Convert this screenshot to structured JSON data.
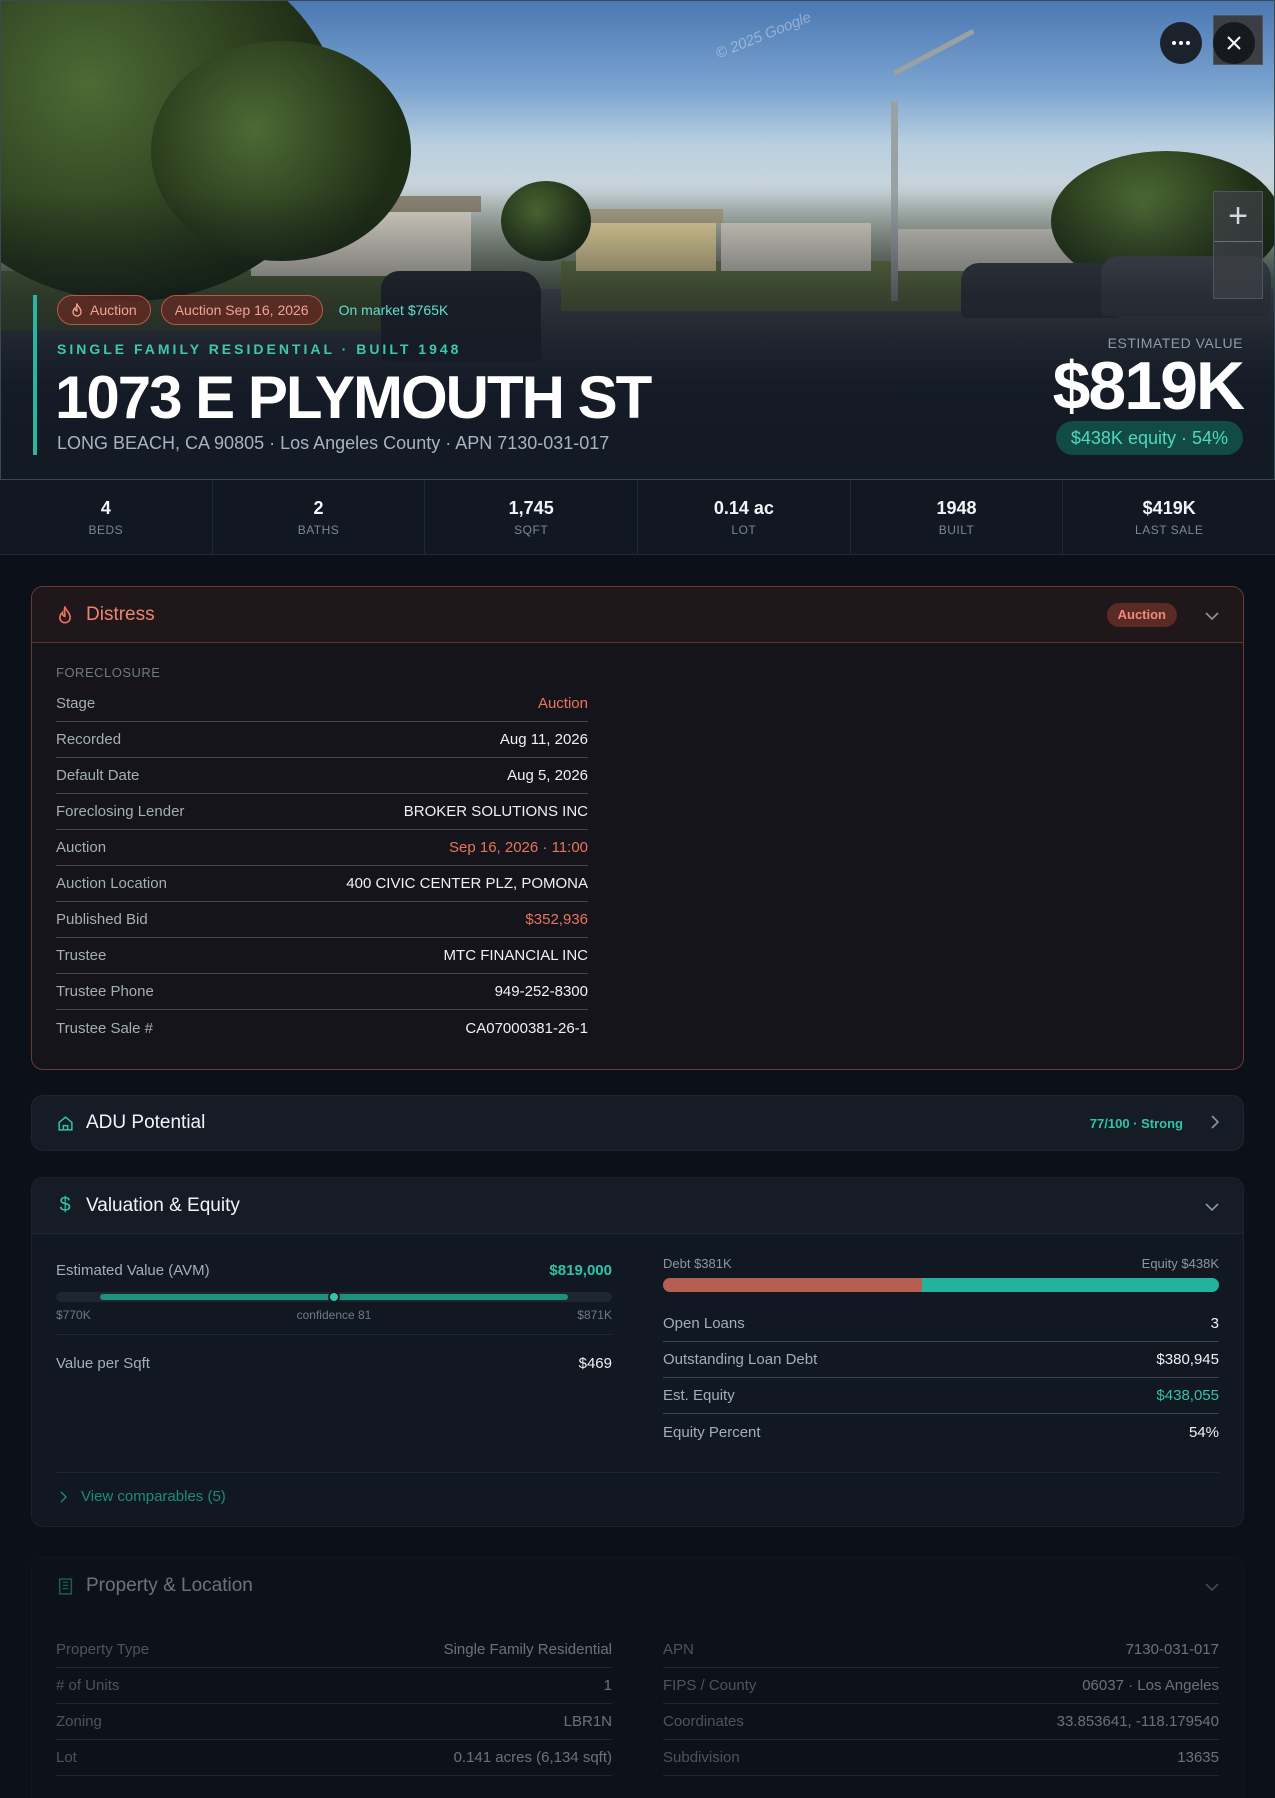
{
  "hero": {
    "watermark": "© 2025 Google",
    "more_icon": "ellipsis-icon",
    "close_icon": "close-icon",
    "zoom_in_icon": "plus-icon",
    "pills": [
      {
        "label": "Auction",
        "icon": "flame-icon"
      },
      {
        "label": "Auction Sep 16, 2026"
      },
      {
        "label": "On market $765K"
      }
    ],
    "subtitle": "SINGLE FAMILY RESIDENTIAL · BUILT 1948",
    "address": "1073 E PLYMOUTH ST",
    "location": "LONG BEACH, CA 90805 · Los Angeles County · APN 7130-031-017",
    "estimated_label": "ESTIMATED VALUE",
    "estimated_value": "$819K",
    "equity": "$438K equity · 54%"
  },
  "stats": [
    {
      "value": "4",
      "label": "BEDS"
    },
    {
      "value": "2",
      "label": "BATHS"
    },
    {
      "value": "1,745",
      "label": "SQFT"
    },
    {
      "value": "0.14 ac",
      "label": "LOT"
    },
    {
      "value": "1948",
      "label": "BUILT"
    },
    {
      "value": "$419K",
      "label": "LAST SALE"
    }
  ],
  "distress": {
    "title": "Distress",
    "icon": "flame-icon",
    "badge": "Auction",
    "section_label": "FORECLOSURE",
    "rows": [
      {
        "k": "Stage",
        "v": "Auction"
      },
      {
        "k": "Recorded",
        "v": "Aug 11, 2026"
      },
      {
        "k": "Default Date",
        "v": "Aug 5, 2026"
      },
      {
        "k": "Foreclosing Lender",
        "v": "BROKER SOLUTIONS INC"
      },
      {
        "k": "Auction",
        "v": "Sep 16, 2026 · 11:00"
      },
      {
        "k": "Auction Location",
        "v": "400 CIVIC CENTER PLZ, POMONA"
      },
      {
        "k": "Published Bid",
        "v": "$352,936"
      },
      {
        "k": "Trustee",
        "v": "MTC FINANCIAL INC"
      },
      {
        "k": "Trustee Phone",
        "v": "949-252-8300"
      },
      {
        "k": "Trustee Sale #",
        "v": "CA07000381-26-1"
      }
    ]
  },
  "adu": {
    "title": "ADU Potential",
    "icon": "home-icon",
    "score": "77/100 · Strong"
  },
  "valuation": {
    "title": "Valuation & Equity",
    "icon": "dollar-icon",
    "avm_label": "Estimated Value (AVM)",
    "avm_value": "$819,000",
    "range_low": "$770K",
    "confidence": "confidence 81",
    "range_high": "$871K",
    "avm_range_fill_start": 0.08,
    "avm_range_fill_end": 0.92,
    "avm_position": 0.5,
    "per_sqft_label": "Value per Sqft",
    "per_sqft_value": "$469",
    "debt_label": "Debt $381K",
    "equity_label": "Equity $438K",
    "debt_fraction": 0.465,
    "debt_color": "#b45f52",
    "equity_color": "#22b39c",
    "rows": [
      {
        "k": "Open Loans",
        "v": "3"
      },
      {
        "k": "Outstanding Loan Debt",
        "v": "$380,945"
      },
      {
        "k": "Est. Equity",
        "v": "$438,055"
      },
      {
        "k": "Equity Percent",
        "v": "54%"
      }
    ],
    "comparables": "View comparables (5)"
  },
  "property": {
    "title": "Property & Location",
    "icon": "building-icon",
    "left_rows": [
      {
        "k": "Property Type",
        "v": "Single Family Residential"
      },
      {
        "k": "# of Units",
        "v": "1"
      },
      {
        "k": "Zoning",
        "v": "LBR1N"
      },
      {
        "k": "Lot",
        "v": "0.141 acres (6,134 sqft)"
      }
    ],
    "right_rows": [
      {
        "k": "APN",
        "v": "7130-031-017"
      },
      {
        "k": "FIPS / County",
        "v": "06037 · Los Angeles"
      },
      {
        "k": "Coordinates",
        "v": "33.853641, -118.179540"
      },
      {
        "k": "Subdivision",
        "v": "13635"
      }
    ]
  }
}
